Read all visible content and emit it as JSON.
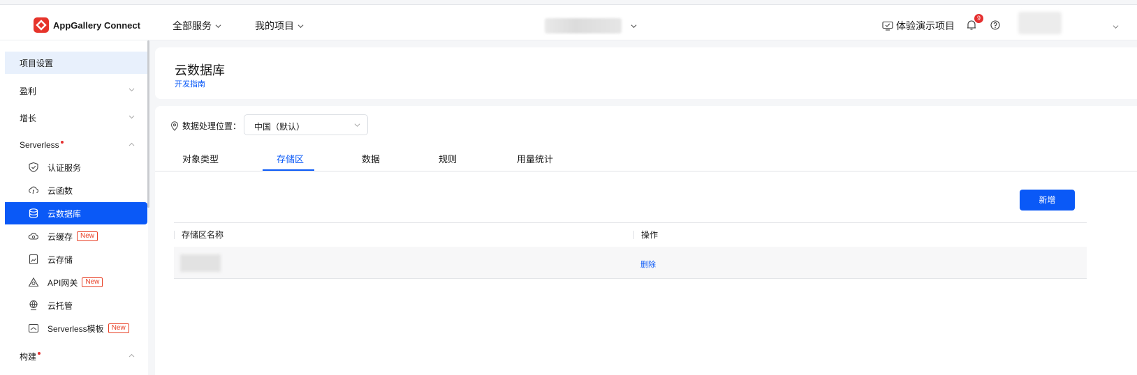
{
  "header": {
    "brand": "AppGallery Connect",
    "menus": [
      "全部服务",
      "我的项目"
    ],
    "demo_project": "体验演示项目",
    "notification_count": "9"
  },
  "sidebar": {
    "project_settings": "项目设置",
    "groups": {
      "monetize": "盈利",
      "growth": "增长",
      "serverless": "Serverless",
      "build": "构建"
    },
    "items": [
      {
        "label": "认证服务",
        "icon": "shield-check-icon"
      },
      {
        "label": "云函数",
        "icon": "cloud-function-icon"
      },
      {
        "label": "云数据库",
        "icon": "database-icon",
        "active": true
      },
      {
        "label": "云缓存",
        "icon": "cloud-cache-icon",
        "tag": "New"
      },
      {
        "label": "云存储",
        "icon": "cloud-storage-icon"
      },
      {
        "label": "API网关",
        "icon": "api-gateway-icon",
        "tag": "New"
      },
      {
        "label": "云托管",
        "icon": "cloud-hosting-icon"
      },
      {
        "label": "Serverless模板",
        "icon": "template-icon",
        "tag": "New"
      }
    ]
  },
  "page": {
    "title": "云数据库",
    "dev_guide": "开发指南"
  },
  "region": {
    "label": "数据处理位置：",
    "value": "中国（默认）"
  },
  "tabs": [
    "对象类型",
    "存储区",
    "数据",
    "规则",
    "用量统计"
  ],
  "active_tab": "存储区",
  "actions": {
    "add": "新增"
  },
  "table": {
    "columns": [
      "存储区名称",
      "操作"
    ],
    "rows": [
      {
        "name": "",
        "action": "删除"
      }
    ]
  },
  "colors": {
    "accent": "#0a59f7",
    "badge": "#e52f2f",
    "new_tag": "#e84026"
  }
}
